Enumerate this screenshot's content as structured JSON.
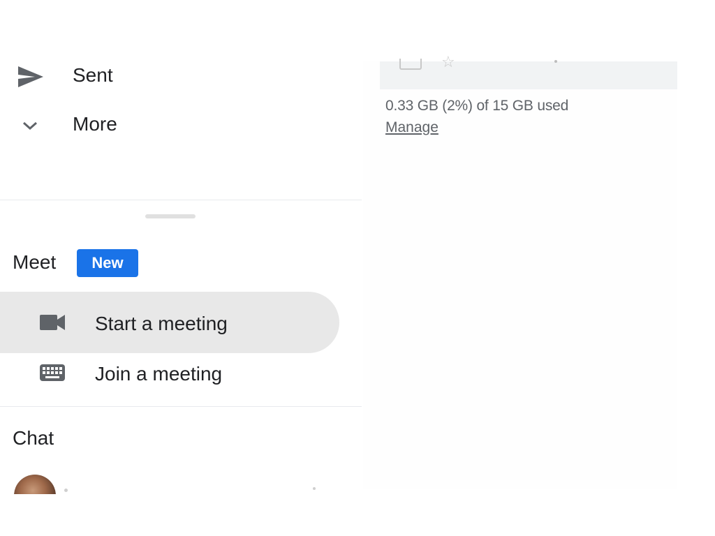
{
  "sidebar": {
    "sent_label": "Sent",
    "more_label": "More",
    "meet": {
      "title": "Meet",
      "badge": "New",
      "start_label": "Start a meeting",
      "join_label": "Join a meeting"
    },
    "chat": {
      "title": "Chat"
    }
  },
  "storage": {
    "usage_text": "0.33 GB (2%) of 15 GB used",
    "manage_label": "Manage"
  },
  "icons": {
    "sent": "send-icon",
    "more": "chevron-down-icon",
    "start_meeting": "video-camera-icon",
    "join_meeting": "keyboard-icon"
  },
  "colors": {
    "accent_blue": "#1a73e8",
    "active_item_bg": "#e8e8e8",
    "text_primary": "#202124",
    "text_secondary": "#5f6368"
  }
}
